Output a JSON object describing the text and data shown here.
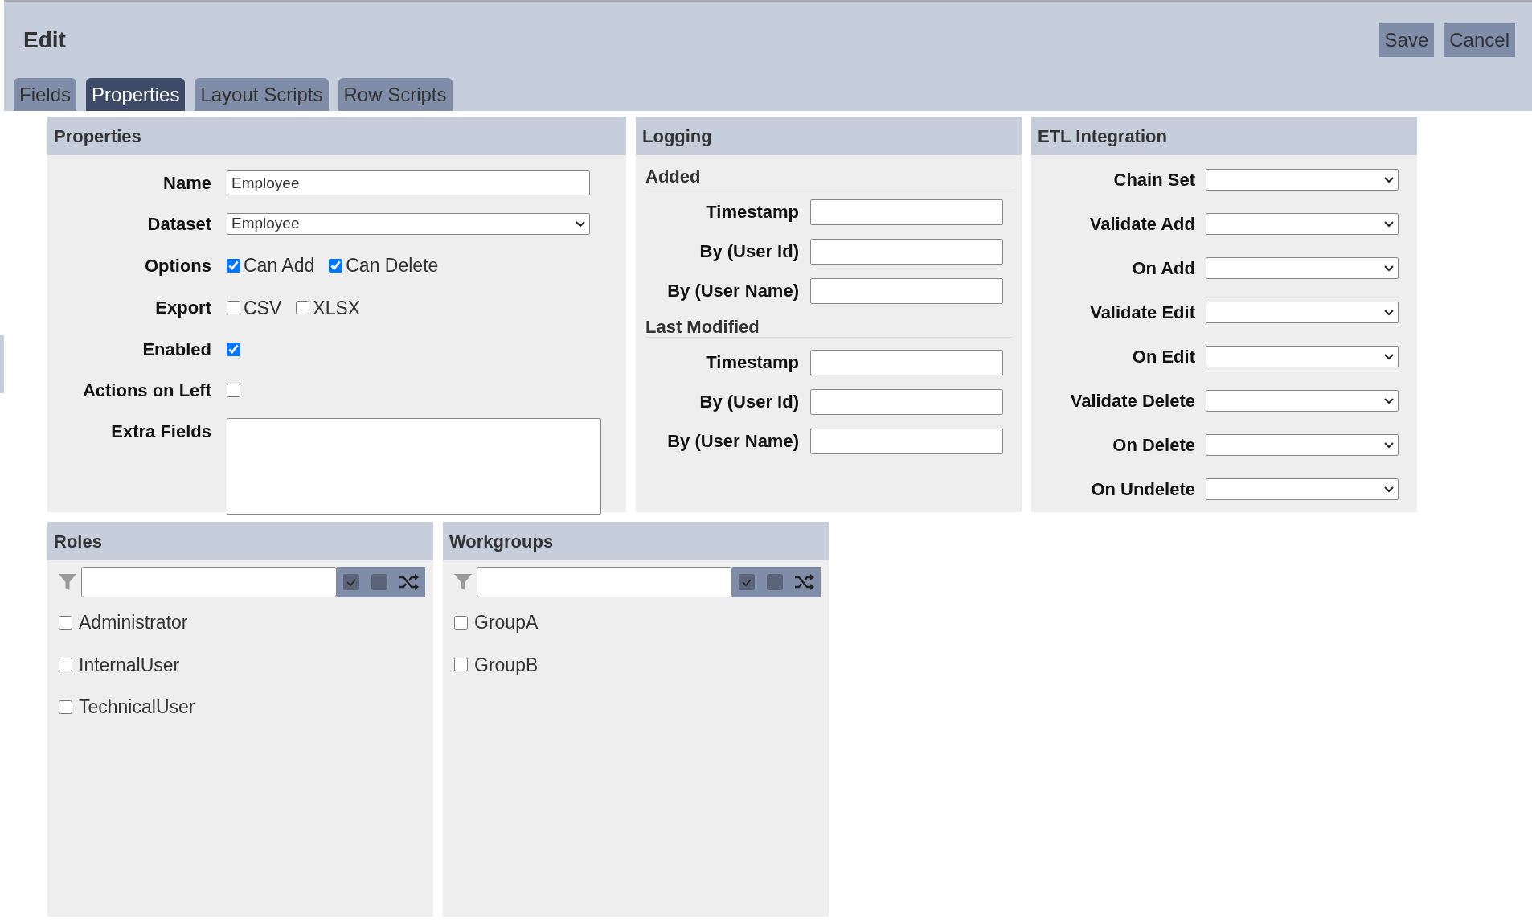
{
  "header": {
    "title": "Edit",
    "buttons": [
      "Save",
      "Cancel"
    ]
  },
  "tabs": [
    {
      "label": "Fields",
      "selected": false
    },
    {
      "label": "Properties",
      "selected": true
    },
    {
      "label": "Layout Scripts",
      "selected": false
    },
    {
      "label": "Row Scripts",
      "selected": false
    }
  ],
  "properties": {
    "title": "Properties",
    "rows": [
      {
        "kind": "text",
        "label": "Name",
        "value": "Employee"
      },
      {
        "kind": "select",
        "label": "Dataset",
        "value": "Employee"
      },
      {
        "kind": "checks",
        "label": "Options",
        "options": [
          {
            "label": "Can Add",
            "checked": true
          },
          {
            "label": "Can Delete",
            "checked": true
          }
        ]
      },
      {
        "kind": "checks",
        "label": "Export",
        "options": [
          {
            "label": "CSV",
            "checked": false
          },
          {
            "label": "XLSX",
            "checked": false
          }
        ]
      },
      {
        "kind": "check",
        "label": "Enabled",
        "checked": true
      },
      {
        "kind": "check",
        "label": "Actions on Left",
        "checked": false
      },
      {
        "kind": "textarea",
        "label": "Extra Fields"
      }
    ]
  },
  "logging": {
    "title": "Logging",
    "sections": [
      {
        "title": "Added",
        "fields": [
          "Timestamp",
          "By (User Id)",
          "By (User Name)"
        ]
      },
      {
        "title": "Last Modified",
        "fields": [
          "Timestamp",
          "By (User Id)",
          "By (User Name)"
        ]
      }
    ]
  },
  "etl": {
    "title": "ETL Integration",
    "fields": [
      "Chain Set",
      "Validate Add",
      "On Add",
      "Validate Edit",
      "On Edit",
      "Validate Delete",
      "On Delete",
      "On Undelete"
    ]
  },
  "lists": [
    {
      "title": "Roles",
      "items": [
        {
          "label": "Administrator",
          "checked": false
        },
        {
          "label": "InternalUser",
          "checked": false
        },
        {
          "label": "TechnicalUser",
          "checked": false
        }
      ]
    },
    {
      "title": "Workgroups",
      "items": [
        {
          "label": "GroupA",
          "checked": false
        },
        {
          "label": "GroupB",
          "checked": false
        }
      ]
    }
  ]
}
